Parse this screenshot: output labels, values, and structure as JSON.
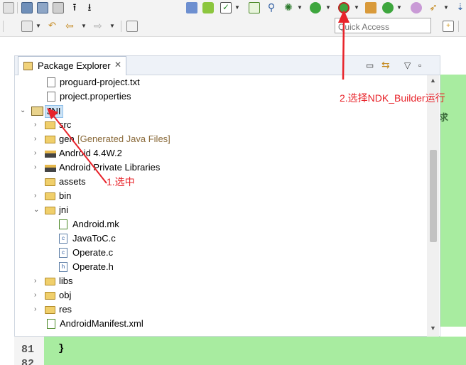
{
  "toolbar": {
    "quick_access_placeholder": "Quick Access"
  },
  "view": {
    "title": "Package Explorer",
    "close_glyph": "✕",
    "minimize_glyph": "▭",
    "link_glyph": "⇆",
    "menu_glyph": "▽",
    "maximize_glyph": "▫"
  },
  "tree": {
    "items": [
      {
        "label": "proguard-project.txt",
        "icon": "file-icon"
      },
      {
        "label": "project.properties",
        "icon": "file-icon"
      },
      {
        "label": "JNI",
        "icon": "project-icon",
        "selected": true
      },
      {
        "label": "src",
        "icon": "package-folder-icon"
      },
      {
        "label": "gen",
        "icon": "package-folder-icon",
        "suffix": "[Generated Java Files]"
      },
      {
        "label": "Android 4.4W.2",
        "icon": "library-icon"
      },
      {
        "label": "Android Private Libraries",
        "icon": "library-icon"
      },
      {
        "label": "assets",
        "icon": "folder-icon"
      },
      {
        "label": "bin",
        "icon": "folder-icon"
      },
      {
        "label": "jni",
        "icon": "folder-icon"
      },
      {
        "label": "Android.mk",
        "icon": "mk-file-icon"
      },
      {
        "label": "JavaToC.c",
        "icon": "c-file-icon"
      },
      {
        "label": "Operate.c",
        "icon": "c-file-icon"
      },
      {
        "label": "Operate.h",
        "icon": "h-file-icon"
      },
      {
        "label": "libs",
        "icon": "folder-icon"
      },
      {
        "label": "obj",
        "icon": "folder-icon"
      },
      {
        "label": "res",
        "icon": "folder-icon"
      },
      {
        "label": "AndroidManifest.xml",
        "icon": "xml-file-icon"
      }
    ]
  },
  "annotations": {
    "step1": "1.选中",
    "step2": "2.选择NDK_Builder运行",
    "color": "#e8232a"
  },
  "editor": {
    "line_81": "81",
    "line_82": "82",
    "code_81": "}",
    "side_char": "求",
    "bg_color": "#a8eca0"
  }
}
